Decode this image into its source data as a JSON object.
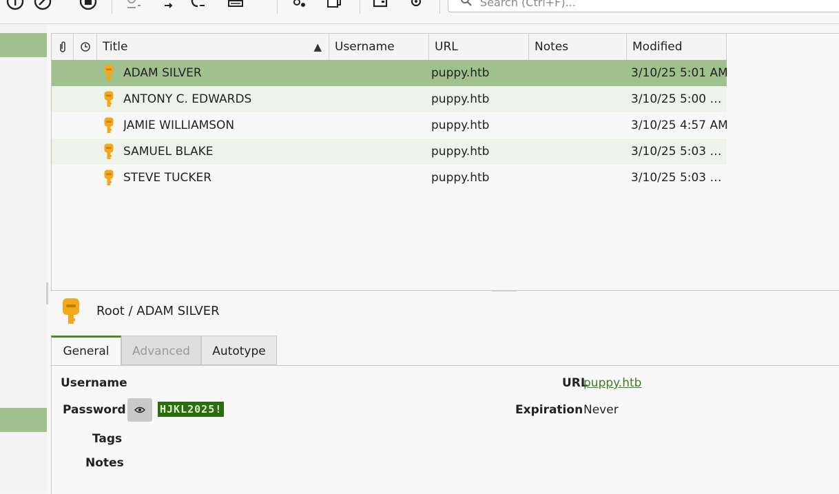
{
  "toolbar": {
    "search_placeholder": "Search (Ctrl+F)..."
  },
  "table": {
    "columns": [
      "Title",
      "Username",
      "URL",
      "Notes",
      "Modified"
    ],
    "sort_indicator": "▲",
    "rows": [
      {
        "title": "ADAM SILVER",
        "username": "",
        "url": "puppy.htb",
        "notes": "",
        "modified": "3/10/25 5:01 AM",
        "selected": true
      },
      {
        "title": "ANTONY C. EDWARDS",
        "username": "",
        "url": "puppy.htb",
        "notes": "",
        "modified": "3/10/25 5:00 …",
        "selected": false
      },
      {
        "title": "JAMIE WILLIAMSON",
        "username": "",
        "url": "puppy.htb",
        "notes": "",
        "modified": "3/10/25 4:57 AM",
        "selected": false
      },
      {
        "title": "SAMUEL BLAKE",
        "username": "",
        "url": "puppy.htb",
        "notes": "",
        "modified": "3/10/25 5:03 …",
        "selected": false
      },
      {
        "title": "STEVE TUCKER",
        "username": "",
        "url": "puppy.htb",
        "notes": "",
        "modified": "3/10/25 5:03 …",
        "selected": false
      }
    ]
  },
  "details": {
    "breadcrumb": "Root / ADAM SILVER",
    "tabs": [
      "General",
      "Advanced",
      "Autotype"
    ],
    "labels": {
      "username": "Username",
      "password": "Password",
      "tags": "Tags",
      "notes": "Notes",
      "url": "URL",
      "expiration": "Expiration"
    },
    "values": {
      "password": "HJKL2025!",
      "url": "puppy.htb",
      "expiration": "Never"
    }
  },
  "colors": {
    "selection": "#9fc18d",
    "accent": "#4a8c1c",
    "key_icon": "#f2a81c"
  }
}
